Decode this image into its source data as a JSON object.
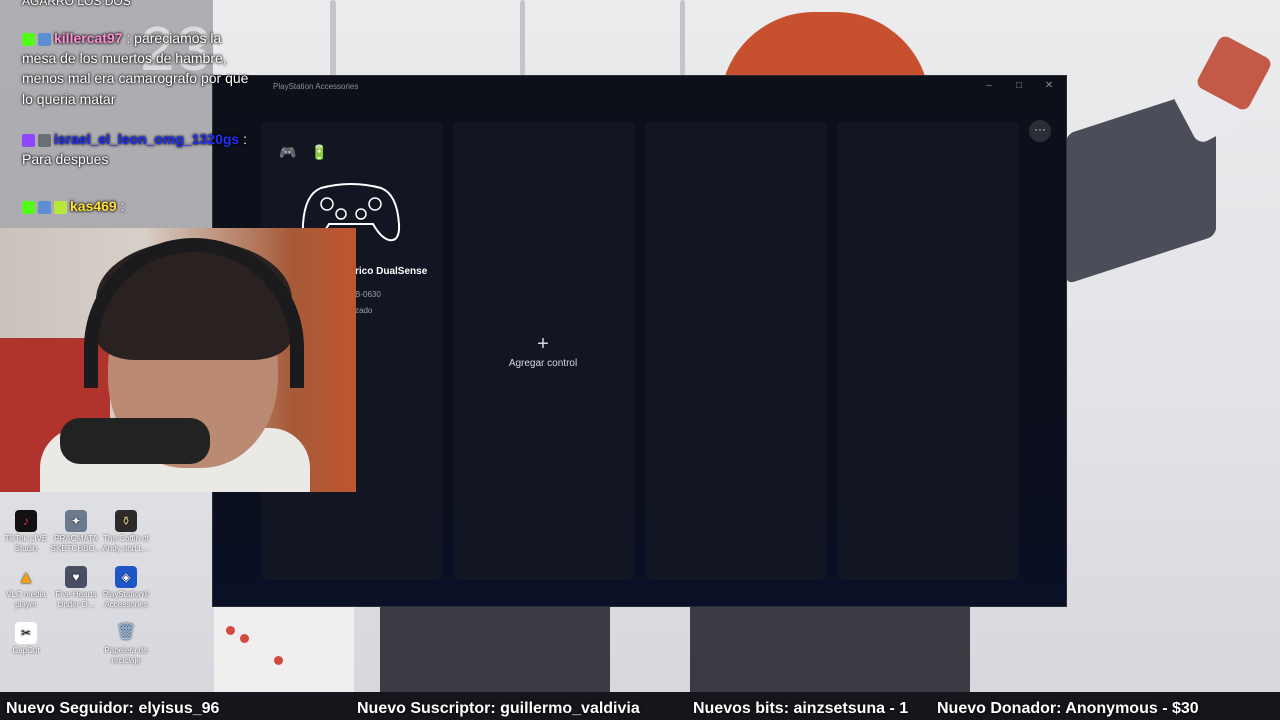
{
  "chat": {
    "clock": "23",
    "top_partial": "AGARRO LOS DOS",
    "messages": [
      {
        "user": "killercat97",
        "sep": " : ",
        "text_lines": [
          "pareciamos la",
          "mesa de los muertos de hambre,",
          "menos mal era camarografo por que",
          "lo queria matar"
        ]
      },
      {
        "user": "israel_el_leon_omg_1320gs",
        "sep": " :",
        "text_lines": [
          "Para despues"
        ]
      },
      {
        "user": "kas469",
        "sep": " :",
        "text_lines": []
      }
    ]
  },
  "desktop_icons": [
    {
      "label": "TikTok LIVE Studio",
      "icon": "tiktok-icon",
      "color": "#111111"
    },
    {
      "label": "PRAGMATA SKETCHBO...",
      "icon": "game-icon",
      "color": "#6b7a8c"
    },
    {
      "label": "The Coffin of Andy and L...",
      "icon": "coffin-icon",
      "color": "#2e2a2a"
    },
    {
      "label": "VLC media player",
      "icon": "vlc-icon",
      "color": "#f39c12"
    },
    {
      "label": "Five Hearts Under O...",
      "icon": "hearts-icon",
      "color": "#4a4e63"
    },
    {
      "label": "PlayStation® Accessories",
      "icon": "playstation-icon",
      "color": "#1e56c8"
    },
    {
      "label": "CapCut",
      "icon": "capcut-icon",
      "color": "#1b1b1b"
    },
    {
      "label": "Papelera de reciclaje",
      "icon": "recycle-bin-icon",
      "color": "#5b8fd0"
    }
  ],
  "app": {
    "title": "PlayStation Accessories",
    "controller_name": "rico DualSense",
    "controller_serial": "B-0630",
    "controller_status": "zado",
    "add_label": "Agregar control",
    "more_label": "···"
  },
  "ticker": {
    "follower": "Nuevo Seguidor: elyisus_96",
    "subscriber": "Nuevo Suscriptor: guillermo_valdivia",
    "bits": "Nuevos bits: ainzsetsuna - 1",
    "donor": "Nuevo Donador: Anonymous - $30"
  }
}
